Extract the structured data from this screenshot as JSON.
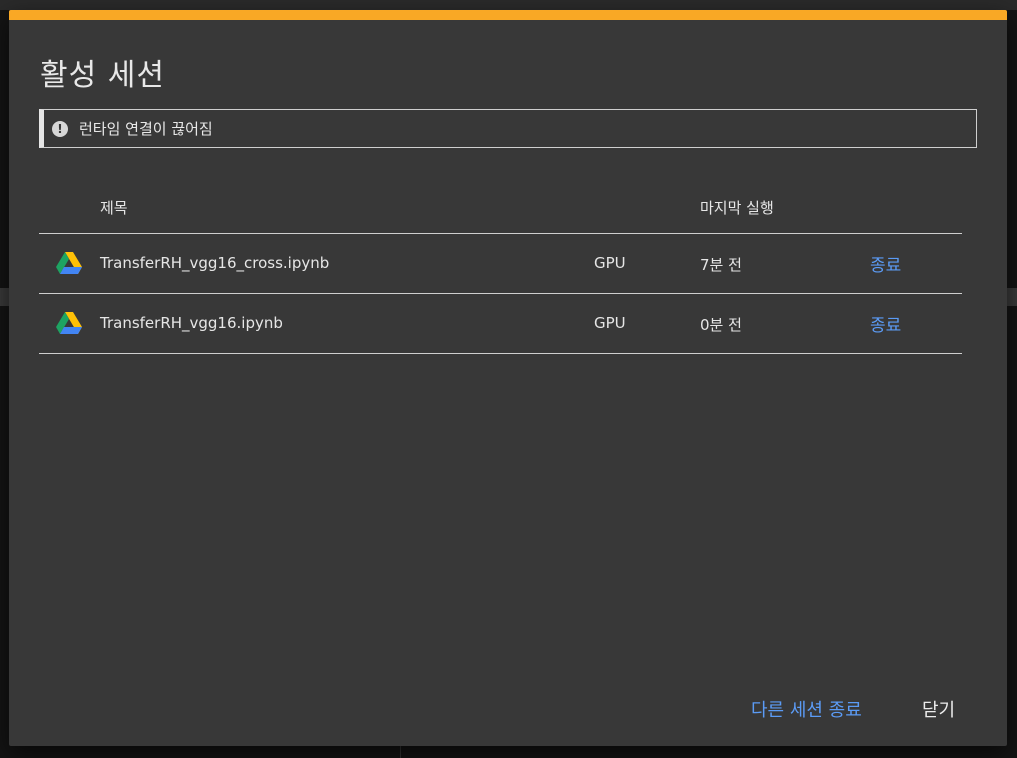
{
  "dialog": {
    "title": "활성 세션",
    "accent_color": "#f9a825",
    "alert": {
      "icon": "exclamation-circle-icon",
      "text": "런타임 연결이 끊어짐"
    },
    "table": {
      "headers": {
        "title": "제목",
        "last_run": "마지막 실행"
      },
      "rows": [
        {
          "icon": "google-drive-icon",
          "name": "TransferRH_vgg16_cross.ipynb",
          "accelerator": "GPU",
          "last_run": "7분 전",
          "action": "종료"
        },
        {
          "icon": "google-drive-icon",
          "name": "TransferRH_vgg16.ipynb",
          "accelerator": "GPU",
          "last_run": "0분 전",
          "action": "종료"
        }
      ]
    },
    "footer": {
      "end_other_sessions": "다른 세션 종료",
      "close": "닫기"
    },
    "link_color": "#5b9bf5"
  }
}
